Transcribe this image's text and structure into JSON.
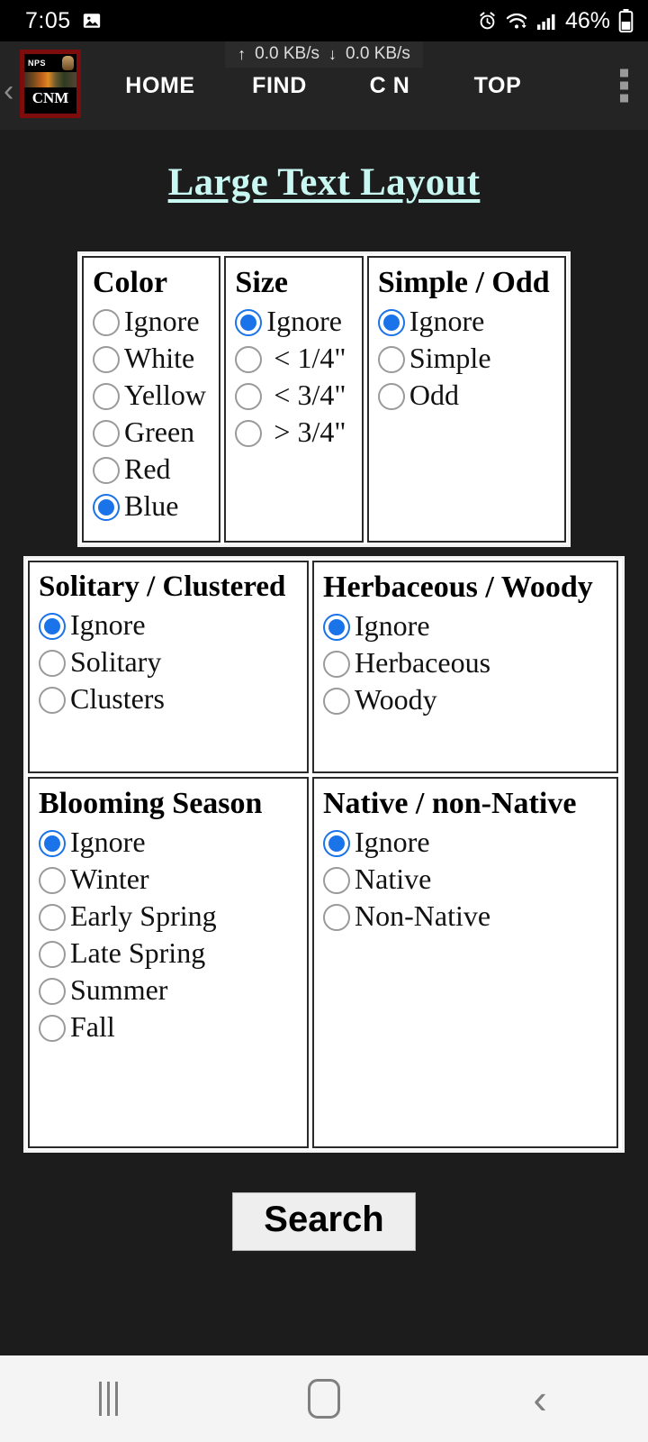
{
  "status_bar": {
    "time": "7:05",
    "screenshot_icon": "image-icon",
    "alarm_icon": "alarm-icon",
    "wifi_icon": "wifi-icon",
    "signal_icon": "signal-bars-icon",
    "battery_percent": "46%",
    "battery_icon": "battery-icon"
  },
  "app_bar": {
    "back_chevron": "‹",
    "net_speed": {
      "up_arrow": "↑",
      "up_value": "0.0 KB/s",
      "down_arrow": "↓",
      "down_value": "0.0 KB/s"
    },
    "logo": {
      "nps": "NPS",
      "cnm": "CNM",
      "arrowhead_icon": "nps-arrowhead-icon"
    },
    "menu": [
      {
        "label": "HOME",
        "name": "menu-item-home"
      },
      {
        "label": "FIND",
        "name": "menu-item-find"
      },
      {
        "label": "C N",
        "name": "menu-item-cn"
      },
      {
        "label": "TOP",
        "name": "menu-item-top"
      }
    ],
    "overflow_icon": "overflow-menu-icon"
  },
  "page": {
    "title": "Large Text Layout"
  },
  "sections": {
    "color": {
      "title": "Color",
      "options": [
        {
          "label": "Ignore",
          "selected": false
        },
        {
          "label": "White",
          "selected": false
        },
        {
          "label": "Yellow",
          "selected": false
        },
        {
          "label": "Green",
          "selected": false
        },
        {
          "label": "Red",
          "selected": false
        },
        {
          "label": "Blue",
          "selected": true
        }
      ]
    },
    "size": {
      "title": "Size",
      "options": [
        {
          "label": "Ignore",
          "selected": true
        },
        {
          "label": "< 1/4\"",
          "selected": false
        },
        {
          "label": "< 3/4\"",
          "selected": false
        },
        {
          "label": "> 3/4\"",
          "selected": false
        }
      ]
    },
    "simple_odd": {
      "title": "Simple / Odd",
      "options": [
        {
          "label": "Ignore",
          "selected": true
        },
        {
          "label": "Simple",
          "selected": false
        },
        {
          "label": "Odd",
          "selected": false
        }
      ]
    },
    "solitary_clustered": {
      "title": "Solitary / Clustered",
      "options": [
        {
          "label": "Ignore",
          "selected": true
        },
        {
          "label": "Solitary",
          "selected": false
        },
        {
          "label": "Clusters",
          "selected": false
        }
      ]
    },
    "herbaceous_woody": {
      "title": "Herbaceous / Woody",
      "options": [
        {
          "label": "Ignore",
          "selected": true
        },
        {
          "label": "Herbaceous",
          "selected": false
        },
        {
          "label": "Woody",
          "selected": false
        }
      ]
    },
    "blooming_season": {
      "title": "Blooming Season",
      "options": [
        {
          "label": "Ignore",
          "selected": true
        },
        {
          "label": "Winter",
          "selected": false
        },
        {
          "label": "Early Spring",
          "selected": false
        },
        {
          "label": "Late Spring",
          "selected": false
        },
        {
          "label": "Summer",
          "selected": false
        },
        {
          "label": "Fall",
          "selected": false
        }
      ]
    },
    "native_nonnative": {
      "title": "Native / non-Native",
      "options": [
        {
          "label": "Ignore",
          "selected": true
        },
        {
          "label": "Native",
          "selected": false
        },
        {
          "label": "Non-Native",
          "selected": false
        }
      ]
    }
  },
  "search": {
    "label": "Search"
  },
  "nav_bar": {
    "recents_icon": "recents-icon",
    "home_icon": "home-icon",
    "back_icon": "back-icon"
  },
  "colors": {
    "accent_radio": "#1a73e8",
    "title_text": "#c9f7f2",
    "page_background": "#1c1c1c",
    "app_bar": "#242424",
    "logo_border": "#7d0d0d"
  }
}
